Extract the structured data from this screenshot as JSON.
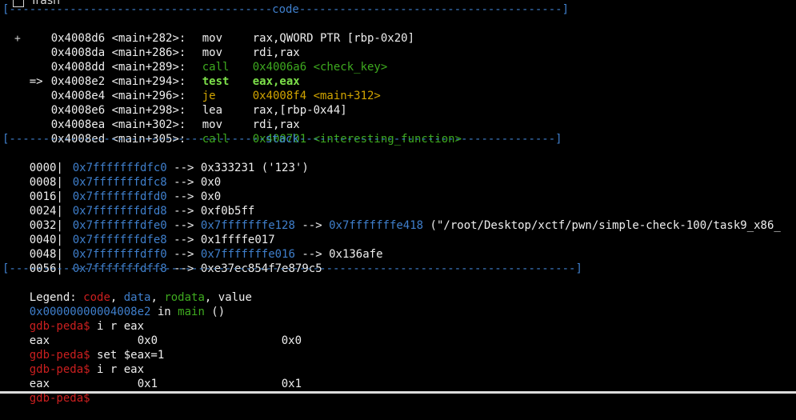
{
  "desktop": {
    "trash_label": "Trash"
  },
  "separators": {
    "code": "[---------------------------------------code---------------------------------------]",
    "stack": "[--------------------------------------stack--------------------------------------]",
    "end": "[------------------------------------------------------------------------------------]"
  },
  "code": [
    {
      "prefix": "",
      "addr": "0x4008d6",
      "sym": "<main+282>:",
      "mnem": "mov",
      "ops": "rax,QWORD PTR [rbp-0x20]",
      "style": "normal"
    },
    {
      "prefix": "",
      "addr": "0x4008da",
      "sym": "<main+286>:",
      "mnem": "mov",
      "ops": "rdi,rax",
      "style": "normal"
    },
    {
      "prefix": "",
      "addr": "0x4008dd",
      "sym": "<main+289>:",
      "mnem": "call",
      "ops": "0x4006a6 <check_key>",
      "style": "call"
    },
    {
      "prefix": "=>",
      "addr": "0x4008e2",
      "sym": "<main+294>:",
      "mnem": "test",
      "ops": "eax,eax",
      "style": "current"
    },
    {
      "prefix": "",
      "addr": "0x4008e4",
      "sym": "<main+296>:",
      "mnem": "je",
      "ops": "0x4008f4 <main+312>",
      "style": "jump"
    },
    {
      "prefix": "",
      "addr": "0x4008e6",
      "sym": "<main+298>:",
      "mnem": "lea",
      "ops": "rax,[rbp-0x44]",
      "style": "normal"
    },
    {
      "prefix": "",
      "addr": "0x4008ea",
      "sym": "<main+302>:",
      "mnem": "mov",
      "ops": "rdi,rax",
      "style": "normal"
    },
    {
      "prefix": "",
      "addr": "0x4008ed",
      "sym": "<main+305>:",
      "mnem": "call",
      "ops": "0x400701 <interesting_function>",
      "style": "call"
    }
  ],
  "stack": [
    {
      "off": "0000|",
      "addr": "0x7fffffffdfc0",
      "arrow": "-->",
      "val": "0x333231 ('123')"
    },
    {
      "off": "0008|",
      "addr": "0x7fffffffdfc8",
      "arrow": "-->",
      "val": "0x0"
    },
    {
      "off": "0016|",
      "addr": "0x7fffffffdfd0",
      "arrow": "-->",
      "val": "0x0"
    },
    {
      "off": "0024|",
      "addr": "0x7fffffffdfd8",
      "arrow": "-->",
      "val": "0xf0b5ff"
    },
    {
      "off": "0032|",
      "addr": "0x7fffffffdfe0",
      "arrow": "-->",
      "ptr": "0x7fffffffe128",
      "arrow2": "-->",
      "ptr2": "0x7fffffffe418",
      "val": "(\"/root/Desktop/xctf/pwn/simple-check-100/task9_x86_"
    },
    {
      "off": "0040|",
      "addr": "0x7fffffffdfe8",
      "arrow": "-->",
      "val": "0x1ffffe017"
    },
    {
      "off": "0048|",
      "addr": "0x7fffffffdff0",
      "arrow": "-->",
      "ptr": "0x7fffffffe016",
      "arrow2": "-->",
      "val": "0x136afe"
    },
    {
      "off": "0056|",
      "addr": "0x7fffffffdff8",
      "arrow": "-->",
      "val": "0xe37ec854f7e879c5"
    }
  ],
  "legend": {
    "label": "Legend:",
    "code": "code",
    "data": "data",
    "rodata": "rodata",
    "value": "value",
    "sep1": ", ",
    "sep2": ", ",
    "sep3": ", "
  },
  "location": {
    "addr": "0x00000000004008e2",
    "in": " in ",
    "func": "main",
    "args": " ()"
  },
  "prompt": "gdb-peda$",
  "session": [
    {
      "type": "cmd",
      "text": " i r eax"
    },
    {
      "type": "reg",
      "name": "eax",
      "hex": "0x0",
      "dec": "0x0"
    },
    {
      "type": "cmd",
      "text": " set $eax=1"
    },
    {
      "type": "cmd",
      "text": " i r eax"
    },
    {
      "type": "reg",
      "name": "eax",
      "hex": "0x1",
      "dec": "0x1"
    },
    {
      "type": "cmd",
      "text": ""
    }
  ],
  "colors": {
    "blue": "#3f7fcc",
    "red": "#cc1f1f",
    "green": "#3eaa1f",
    "yellow": "#d1a400",
    "white": "#eeeeee",
    "bright": "#7de04a",
    "background": "#000000"
  }
}
